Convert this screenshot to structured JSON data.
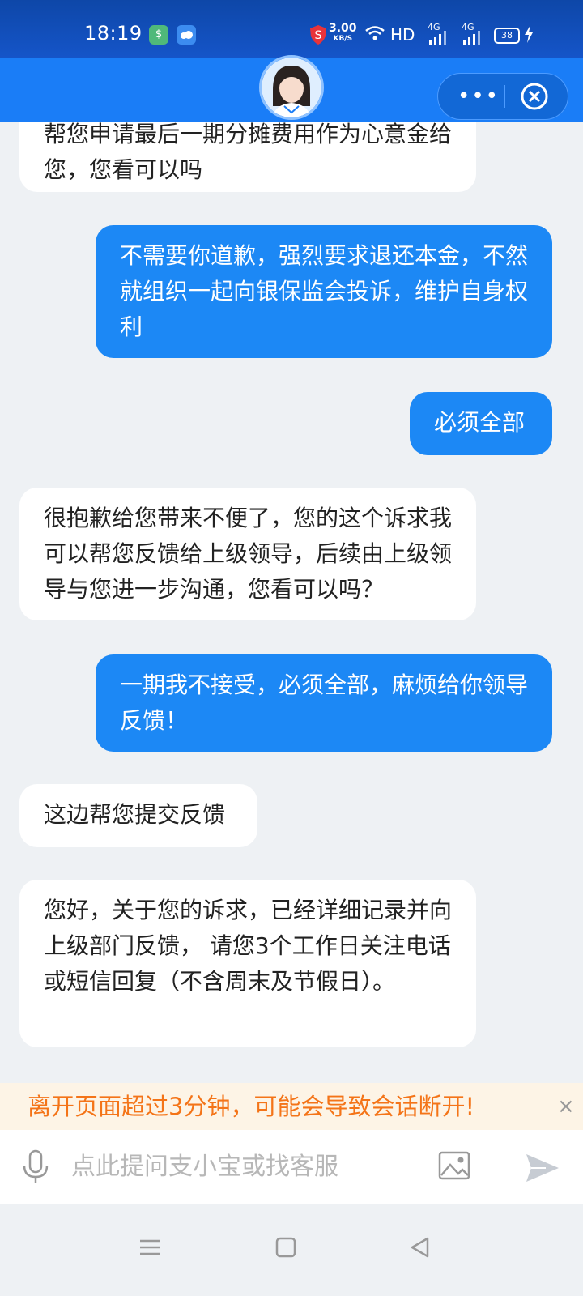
{
  "status_bar": {
    "time": "18:19",
    "net_speed_value": "3.00",
    "net_speed_unit": "KB/S",
    "hd_label": "HD",
    "signal1_label": "4G",
    "signal2_label": "4G",
    "battery_level": "38"
  },
  "header": {
    "more_label": "•••"
  },
  "messages": [
    {
      "side": "in",
      "text": "帮您申请最后一期分摊费用作为心意金给您，您看可以吗"
    },
    {
      "side": "out",
      "text": "不需要你道歉，强烈要求退还本金，不然就组织一起向银保监会投诉，维护自身权利"
    },
    {
      "side": "out",
      "text": "必须全部"
    },
    {
      "side": "in",
      "text": "很抱歉给您带来不便了，您的这个诉求我可以帮您反馈给上级领导，后续由上级领导与您进一步沟通，您看可以吗？"
    },
    {
      "side": "out",
      "text": "一期我不接受，必须全部，麻烦给你领导反馈！"
    },
    {
      "side": "in",
      "text": "这边帮您提交反馈"
    },
    {
      "side": "in",
      "text": "您好，关于您的诉求，已经详细记录并向上级部门反馈， 请您3个工作日关注电话或短信回复（不含周末及节假日）。"
    }
  ],
  "notice": {
    "text": "离开页面超过3分钟，可能会导致会话断开!",
    "close": "×"
  },
  "input": {
    "placeholder": "点此提问支小宝或找客服"
  },
  "colors": {
    "header": "#1a7df7",
    "outgoing_bubble": "#1c88f5",
    "notice_text": "#f47418"
  }
}
